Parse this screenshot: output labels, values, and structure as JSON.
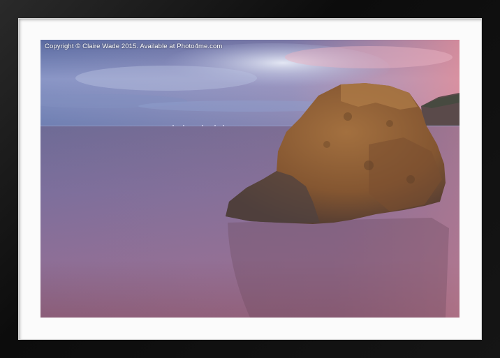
{
  "photo": {
    "watermark": "Copyright © Claire Wade 2015. Available at Photo4me.com"
  },
  "colors": {
    "frame": "#111111",
    "mount": "#fbfbfb",
    "sky_top": "#5a6ea3",
    "sea": "#7b6f99",
    "sand": "#a77287",
    "rock": "#8a5a35"
  }
}
